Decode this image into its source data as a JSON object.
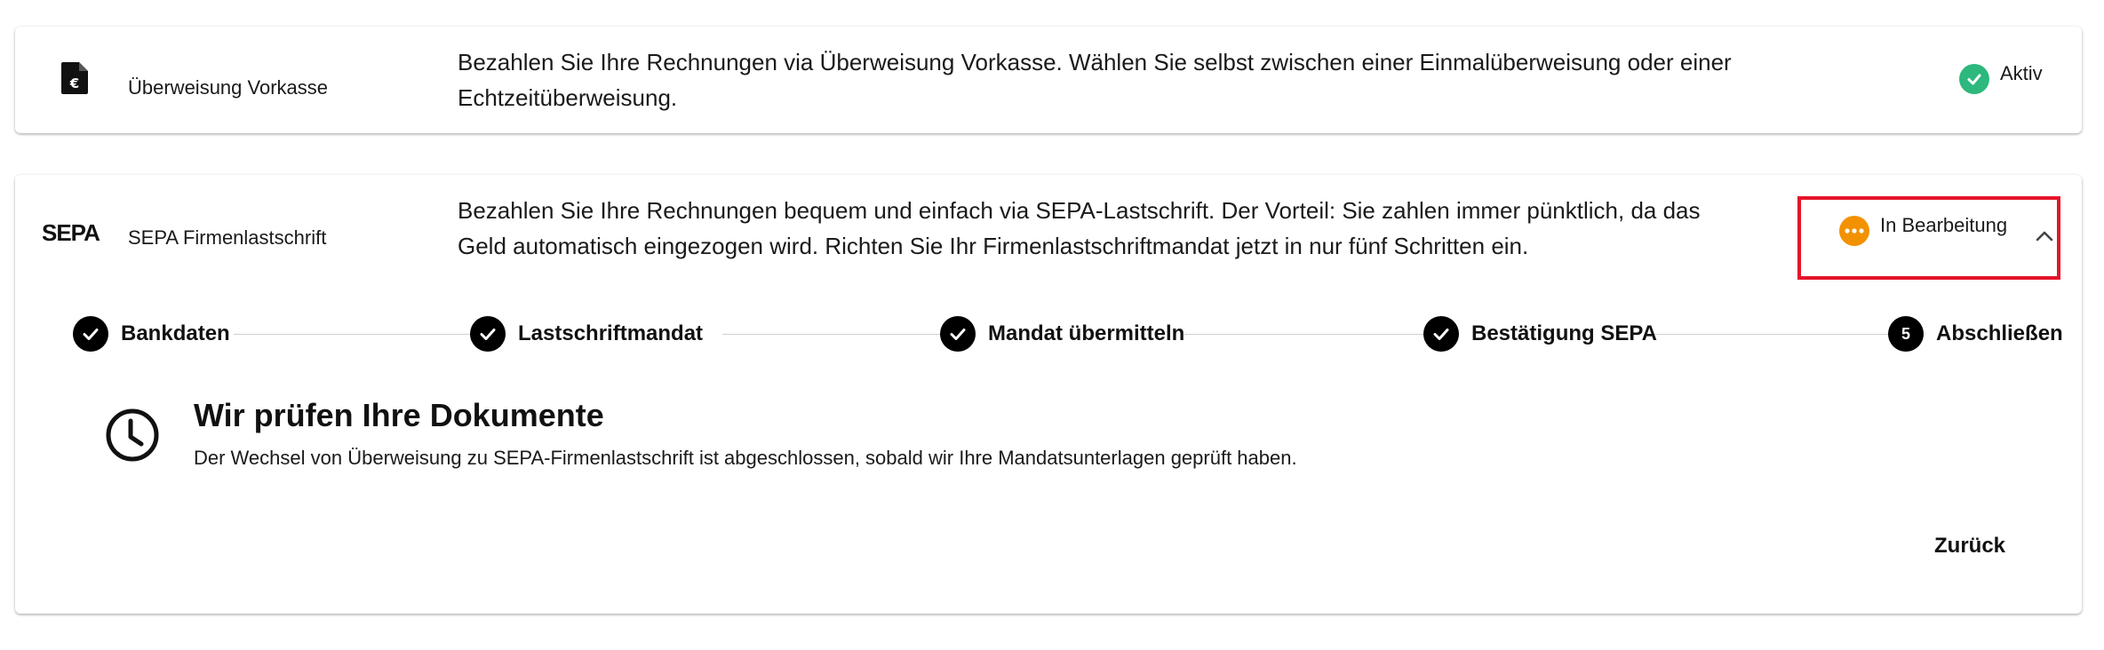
{
  "payment_methods": [
    {
      "name": "Überweisung Vorkasse",
      "icon": "invoice-euro-icon",
      "description": "Bezahlen Sie Ihre Rechnungen via Überweisung Vorkasse. Wählen Sie selbst zwischen einer Einmalüberweisung oder einer Echtzeitüberweisung.",
      "status": "Aktiv",
      "status_icon": "check-circle-icon",
      "status_color": "#2db87d"
    },
    {
      "name": "SEPA Firmenlastschrift",
      "icon": "sepa-logo",
      "logo_text": "SEPA",
      "description": "Bezahlen Sie Ihre Rechnungen bequem und einfach via SEPA-Lastschrift. Der Vorteil: Sie zahlen immer pünktlich, da das Geld automatisch eingezogen wird. Richten Sie Ihr Firmenlastschriftmandat jetzt in nur fünf Schritten ein.",
      "status": "In Bearbeitung",
      "status_icon": "pending-dots-icon",
      "status_color": "#f39200",
      "highlight_color": "#e5142a",
      "expanded": true
    }
  ],
  "stepper": {
    "steps": [
      {
        "label": "Bankdaten",
        "state": "done"
      },
      {
        "label": "Lastschriftmandat",
        "state": "done"
      },
      {
        "label": "Mandat übermitteln",
        "state": "done"
      },
      {
        "label": "Bestätigung SEPA",
        "state": "done"
      },
      {
        "label": "Abschließen",
        "state": "current",
        "number": "5"
      }
    ]
  },
  "info": {
    "icon": "clock-icon",
    "title": "Wir prüfen Ihre Dokumente",
    "text": "Der Wechsel von Überweisung zu SEPA-Firmenlastschrift ist abgeschlossen, sobald wir Ihre Mandatsunterlagen geprüft haben."
  },
  "actions": {
    "back_label": "Zurück"
  }
}
